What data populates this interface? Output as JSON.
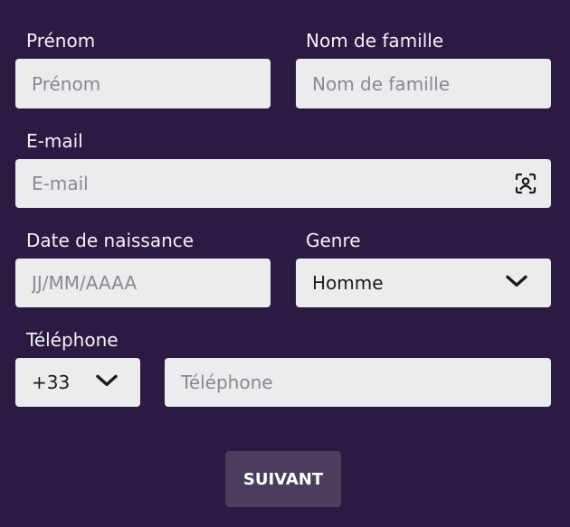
{
  "form": {
    "first_name": {
      "label": "Prénom",
      "placeholder": "Prénom",
      "value": ""
    },
    "last_name": {
      "label": "Nom de famille",
      "placeholder": "Nom de famille",
      "value": ""
    },
    "email": {
      "label": "E-mail",
      "placeholder": "E-mail",
      "value": "",
      "icon": "contact-id-icon"
    },
    "birth_date": {
      "label": "Date de naissance",
      "placeholder": "JJ/MM/AAAA",
      "value": ""
    },
    "gender": {
      "label": "Genre",
      "selected": "Homme",
      "icon": "chevron-down-icon"
    },
    "phone": {
      "label": "Téléphone",
      "country_code": "+33",
      "placeholder": "Téléphone",
      "value": ""
    },
    "submit_label": "SUIVANT"
  },
  "colors": {
    "background": "#2b1b43",
    "field_background": "#ececee",
    "button_background": "#4b3d5c",
    "label_text": "#f4f1f8"
  }
}
